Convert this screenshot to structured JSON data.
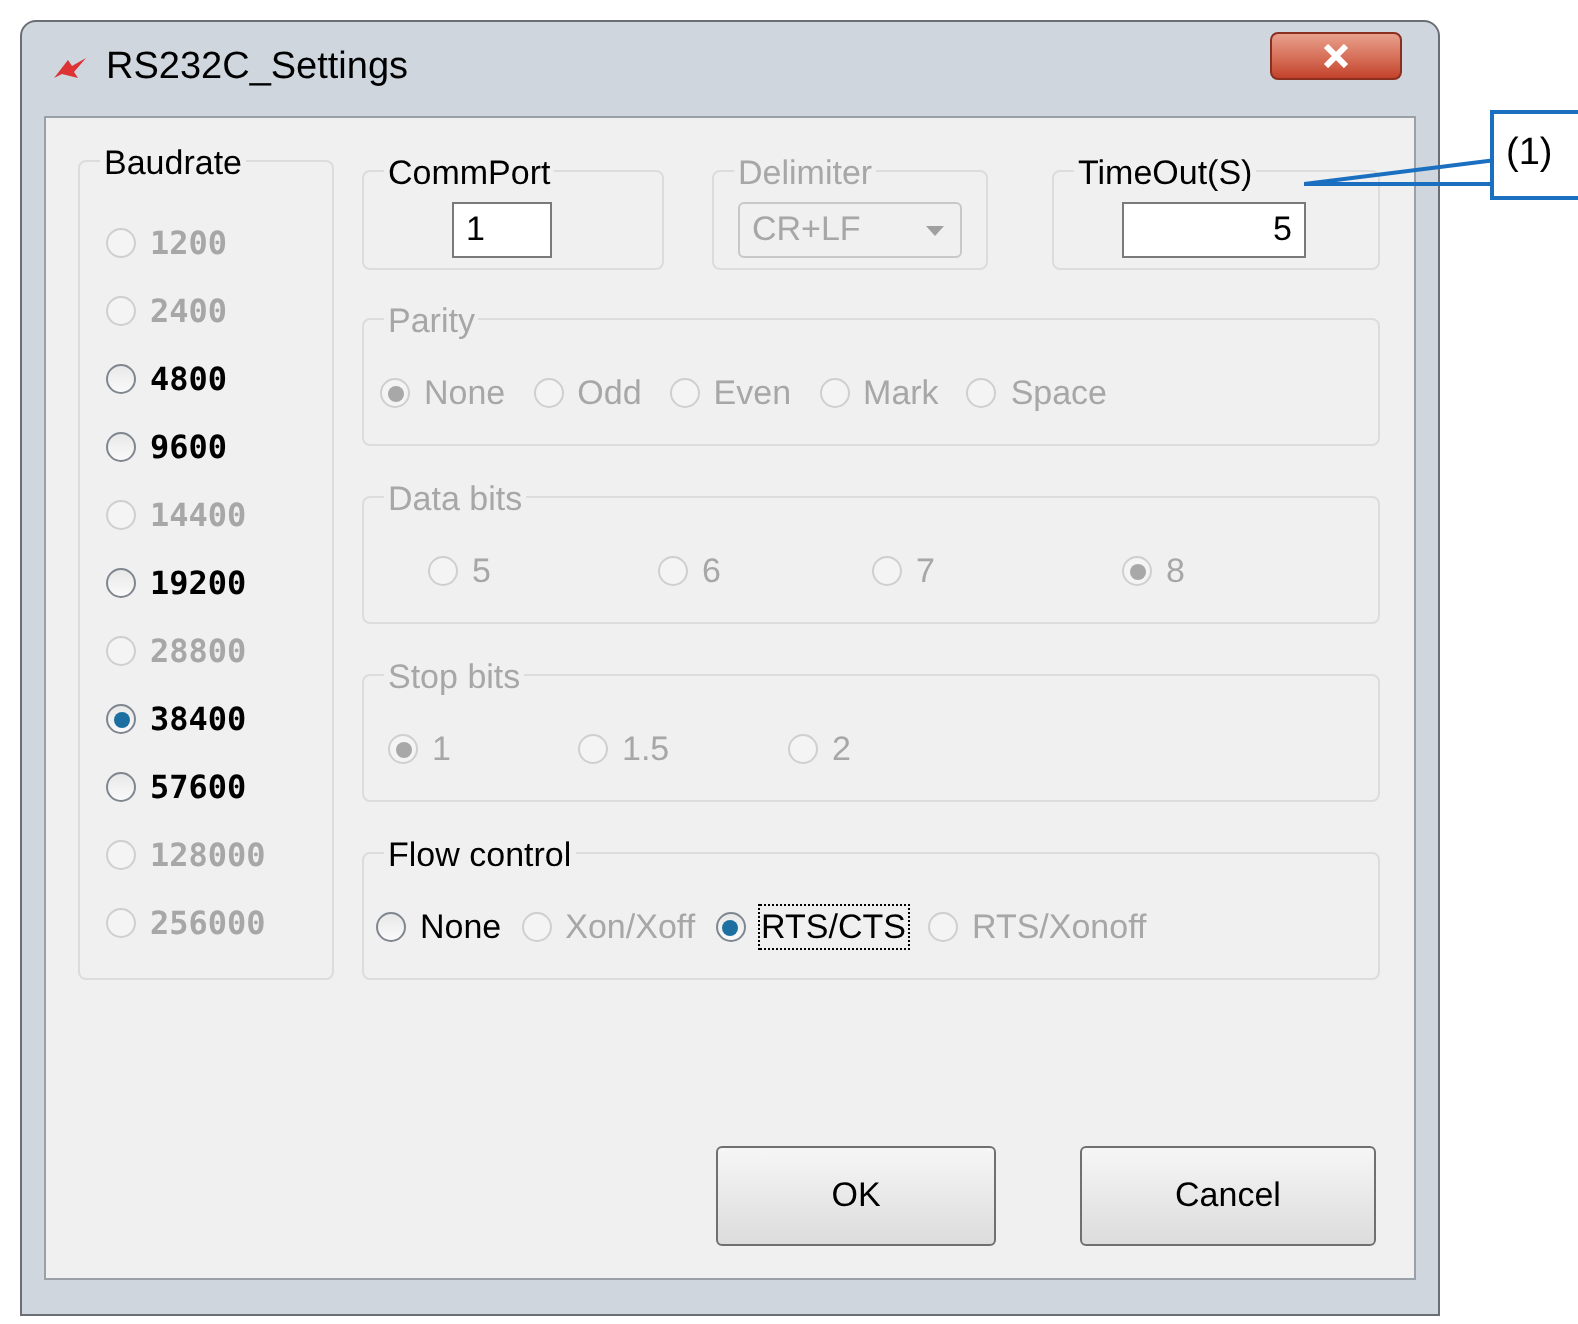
{
  "window": {
    "title": "RS232C_Settings"
  },
  "baudrate": {
    "label": "Baudrate",
    "options": [
      {
        "label": "1200",
        "selected": false,
        "disabled": true
      },
      {
        "label": "2400",
        "selected": false,
        "disabled": true
      },
      {
        "label": "4800",
        "selected": false,
        "disabled": false
      },
      {
        "label": "9600",
        "selected": false,
        "disabled": false
      },
      {
        "label": "14400",
        "selected": false,
        "disabled": true
      },
      {
        "label": "19200",
        "selected": false,
        "disabled": false
      },
      {
        "label": "28800",
        "selected": false,
        "disabled": true
      },
      {
        "label": "38400",
        "selected": true,
        "disabled": false
      },
      {
        "label": "57600",
        "selected": false,
        "disabled": false
      },
      {
        "label": "128000",
        "selected": false,
        "disabled": true
      },
      {
        "label": "256000",
        "selected": false,
        "disabled": true
      }
    ]
  },
  "commport": {
    "label": "CommPort",
    "value": "1"
  },
  "delimiter": {
    "label": "Delimiter",
    "value": "CR+LF",
    "disabled": true
  },
  "timeout": {
    "label": "TimeOut(S)",
    "value": "5"
  },
  "groups": [
    {
      "label": "Parity",
      "disabled": true,
      "options": [
        {
          "label": "None",
          "selected": true,
          "disabled": true,
          "focused": false
        },
        {
          "label": "Odd",
          "selected": false,
          "disabled": true,
          "focused": false
        },
        {
          "label": "Even",
          "selected": false,
          "disabled": true,
          "focused": false
        },
        {
          "label": "Mark",
          "selected": false,
          "disabled": true,
          "focused": false
        },
        {
          "label": "Space",
          "selected": false,
          "disabled": true,
          "focused": false
        }
      ]
    },
    {
      "label": "Data bits",
      "disabled": true,
      "options": [
        {
          "label": "5",
          "selected": false,
          "disabled": true,
          "focused": false
        },
        {
          "label": "6",
          "selected": false,
          "disabled": true,
          "focused": false
        },
        {
          "label": "7",
          "selected": false,
          "disabled": true,
          "focused": false
        },
        {
          "label": "8",
          "selected": true,
          "disabled": true,
          "focused": false
        }
      ]
    },
    {
      "label": "Stop bits",
      "disabled": true,
      "options": [
        {
          "label": "1",
          "selected": true,
          "disabled": true,
          "focused": false
        },
        {
          "label": "1.5",
          "selected": false,
          "disabled": true,
          "focused": false
        },
        {
          "label": "2",
          "selected": false,
          "disabled": true,
          "focused": false
        }
      ]
    },
    {
      "label": "Flow control",
      "disabled": false,
      "options": [
        {
          "label": "None",
          "selected": false,
          "disabled": false,
          "focused": false
        },
        {
          "label": "Xon/Xoff",
          "selected": false,
          "disabled": true,
          "focused": false
        },
        {
          "label": "RTS/CTS",
          "selected": true,
          "disabled": false,
          "focused": true
        },
        {
          "label": "RTS/Xonoff",
          "selected": false,
          "disabled": true,
          "focused": false
        }
      ]
    }
  ],
  "buttons": [
    "OK",
    "Cancel"
  ],
  "callout": {
    "label": "(1)"
  }
}
